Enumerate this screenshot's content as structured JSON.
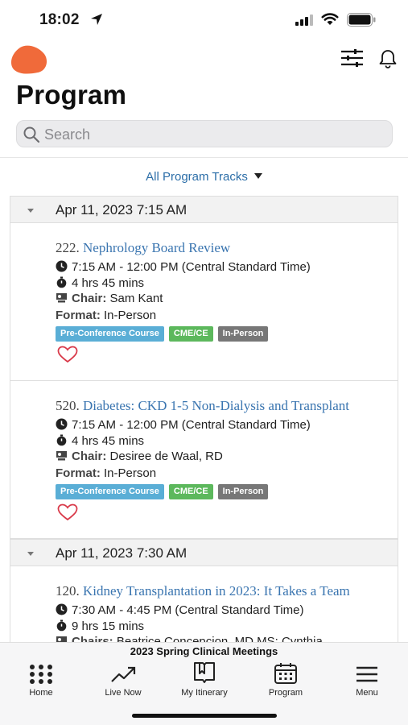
{
  "status_bar": {
    "time": "18:02"
  },
  "header": {
    "title": "Program"
  },
  "search": {
    "placeholder": "Search"
  },
  "filter": {
    "label": "All Program Tracks"
  },
  "colors": {
    "accent": "#3a75b0",
    "logo": "#f06a3a",
    "badge_pre": "#5aaed6",
    "badge_cme": "#5cb85c",
    "badge_inperson": "#777777"
  },
  "groups": [
    {
      "title": "Apr 11, 2023 7:15 AM",
      "sessions": [
        {
          "number": "222.",
          "title": "Nephrology Board Review",
          "time": "7:15 AM - 12:00 PM (Central Standard Time)",
          "duration": "4 hrs 45 mins",
          "chair_label": "Chair:",
          "chair": "Sam Kant",
          "format_label": "Format:",
          "format": "In-Person",
          "badges": [
            "Pre-Conference Course",
            "CME/CE",
            "In-Person"
          ]
        },
        {
          "number": "520.",
          "title": "Diabetes: CKD 1-5 Non-Dialysis and Transplant",
          "time": "7:15 AM - 12:00 PM (Central Standard Time)",
          "duration": "4 hrs 45 mins",
          "chair_label": "Chair:",
          "chair": "Desiree de Waal, RD",
          "format_label": "Format:",
          "format": "In-Person",
          "badges": [
            "Pre-Conference Course",
            "CME/CE",
            "In-Person"
          ]
        }
      ]
    },
    {
      "title": "Apr 11, 2023 7:30 AM",
      "sessions": [
        {
          "number": "120.",
          "title": "Kidney Transplantation in 2023: It Takes a Team",
          "time": "7:30 AM - 4:45 PM (Central Standard Time)",
          "duration": "9 hrs 15 mins",
          "chair_label": "Chairs:",
          "chair": "Beatrice Concepcion, MD MS; Cynthia"
        }
      ]
    }
  ],
  "bottom": {
    "conference_name": "2023 Spring Clinical Meetings",
    "tabs": [
      "Home",
      "Live Now",
      "My Itinerary",
      "Program",
      "Menu"
    ]
  }
}
